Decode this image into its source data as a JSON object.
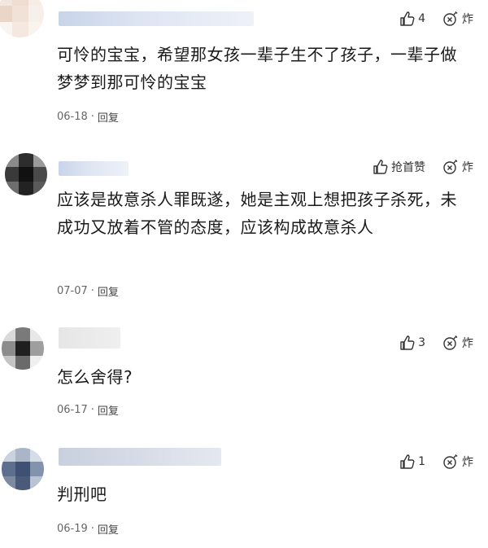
{
  "comments": [
    {
      "likes": "4",
      "bomb_label": "炸",
      "text": "可怜的宝宝，希望那女孩一辈子生不了孩子，一辈子做梦梦到那可怜的宝宝",
      "date": "06-18",
      "dot": "·",
      "reply": "回复"
    },
    {
      "likes": "抢首赞",
      "bomb_label": "炸",
      "text": "应该是故意杀人罪既遂，她是主观上想把孩子杀死，未成功又放着不管的态度，应该构成故意杀人",
      "date": "07-07",
      "dot": "·",
      "reply": "回复"
    },
    {
      "likes": "3",
      "bomb_label": "炸",
      "text": "怎么舍得?",
      "date": "06-17",
      "dot": "·",
      "reply": "回复"
    },
    {
      "likes": "1",
      "bomb_label": "炸",
      "text": "判刑吧",
      "date": "06-19",
      "dot": "·",
      "reply": "回复"
    }
  ],
  "colors": {
    "text": "#1a1a1a",
    "meta": "#666666",
    "username_blur": "#c9d4ea"
  },
  "icons": {
    "like": "thumbs-up-icon",
    "bomb": "bomb-icon"
  }
}
